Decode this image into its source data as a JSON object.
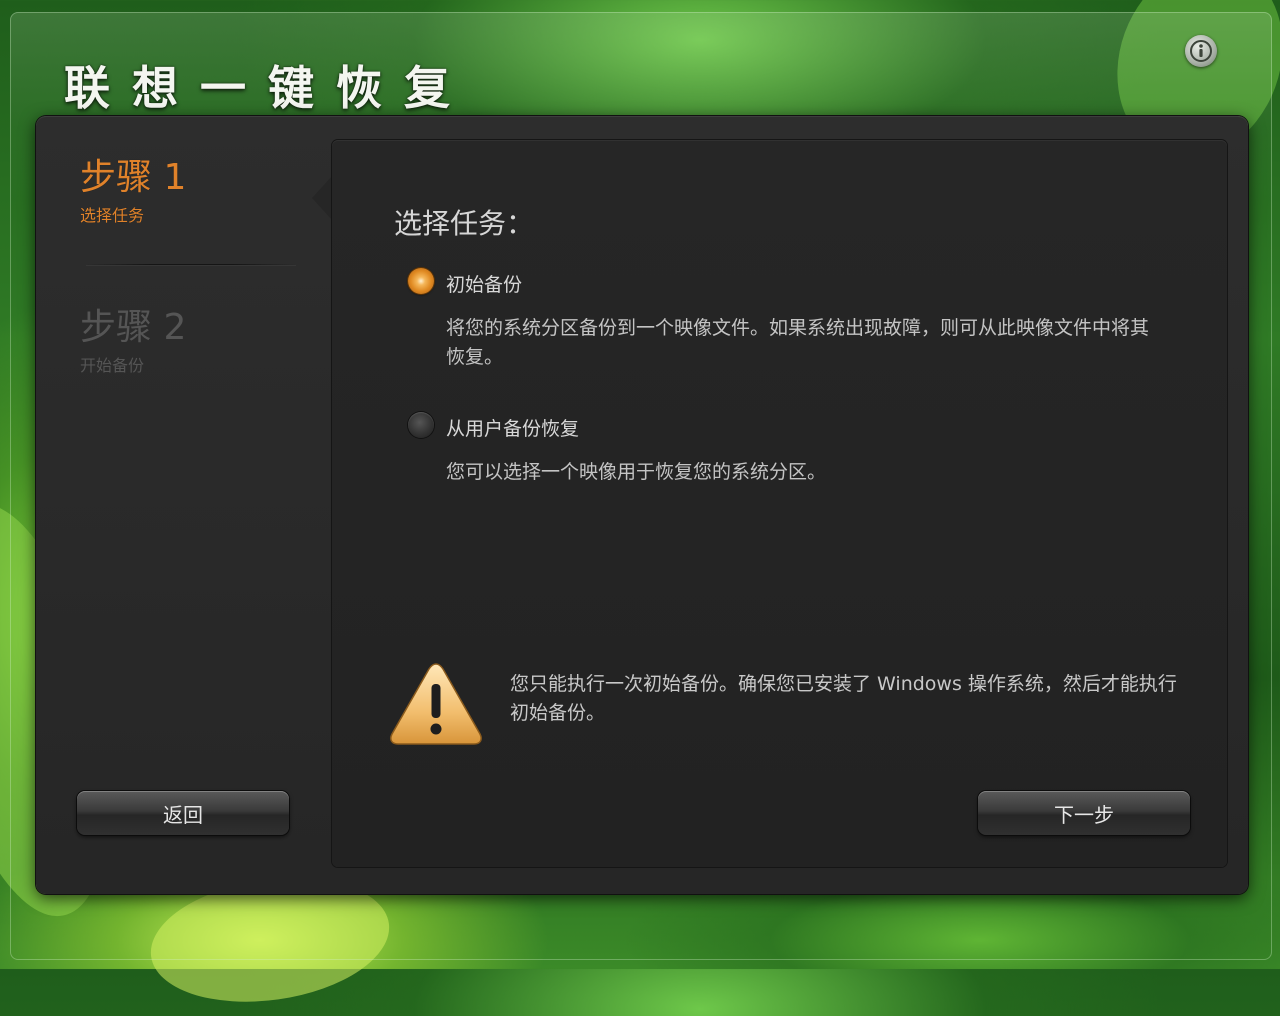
{
  "app": {
    "title": "联想一键恢复"
  },
  "header": {
    "info_button": "info-icon"
  },
  "sidebar": {
    "steps": [
      {
        "title": "步骤 1",
        "subtitle": "选择任务",
        "state": "active"
      },
      {
        "title": "步骤 2",
        "subtitle": "开始备份",
        "state": "inactive"
      }
    ]
  },
  "main": {
    "section_title": "选择任务：",
    "options": [
      {
        "label": "初始备份",
        "description": "将您的系统分区备份到一个映像文件。如果系统出现故障，则可从此映像文件中将其恢复。",
        "selected": true
      },
      {
        "label": "从用户备份恢复",
        "description": "您可以选择一个映像用于恢复您的系统分区。",
        "selected": false
      }
    ],
    "warning": {
      "icon": "warning-icon",
      "text": "您只能执行一次初始备份。确保您已安装了 Windows 操作系统，然后才能执行初始备份。"
    }
  },
  "footer": {
    "back_label": "返回",
    "next_label": "下一步"
  },
  "colors": {
    "accent": "#e0822a",
    "panel": "#2a2a2a",
    "background": "#2f7a25"
  }
}
